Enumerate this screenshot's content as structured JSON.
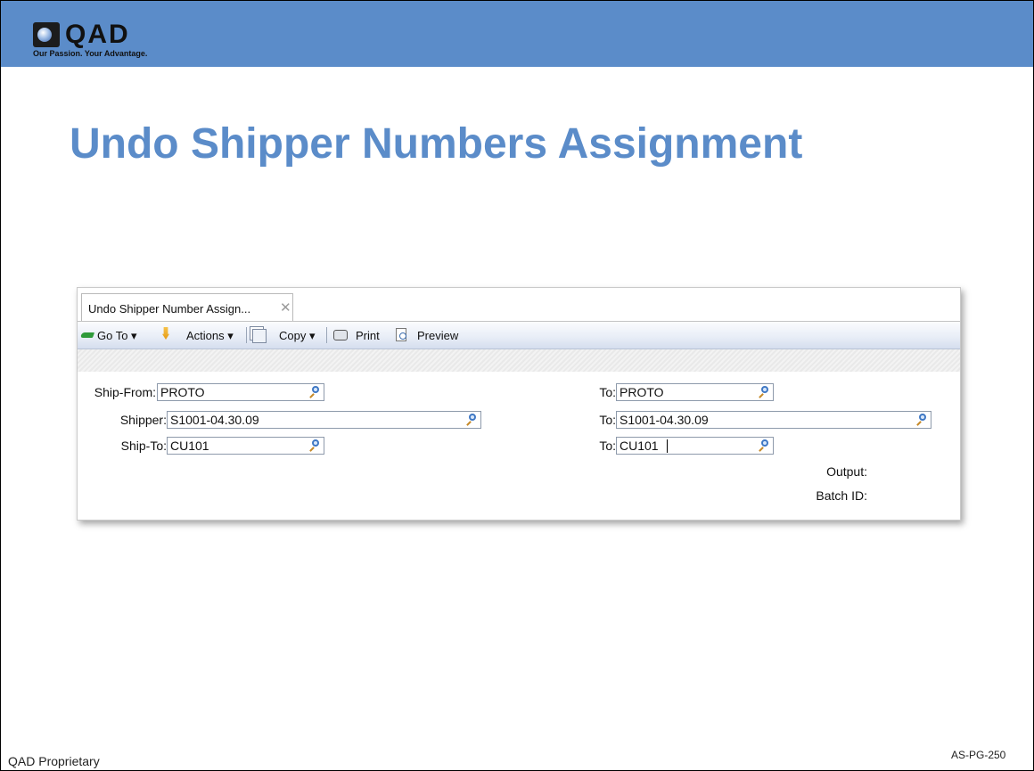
{
  "brand": {
    "name": "QAD",
    "tagline": "Our Passion. Your Advantage.",
    "header_color": "#5b8cc9",
    "icon": "qad-logo-icon"
  },
  "slide": {
    "title": "Undo Shipper Numbers Assignment",
    "footer_left": "QAD Proprietary",
    "footer_right": "AS-PG-250"
  },
  "app": {
    "tab": {
      "label": "Undo Shipper Number Assign...",
      "close_glyph": "✕"
    },
    "toolbar": {
      "goto_label": "Go To ▾",
      "actions_label": "Actions ▾",
      "copy_label": "Copy ▾",
      "print_label": "Print",
      "preview_label": "Preview"
    },
    "form": {
      "ship_from": {
        "label": "Ship-From:",
        "value": "PROTO"
      },
      "ship_from_to": {
        "label": "To:",
        "value": "PROTO"
      },
      "shipper": {
        "label": "Shipper:",
        "value": "S1001-04.30.09"
      },
      "shipper_to": {
        "label": "To:",
        "value": "S1001-04.30.09"
      },
      "ship_to": {
        "label": "Ship-To:",
        "value": "CU101"
      },
      "ship_to_to": {
        "label": "To:",
        "value": "CU101"
      },
      "output": {
        "label": "Output:"
      },
      "batch_id": {
        "label": "Batch ID:"
      }
    }
  }
}
